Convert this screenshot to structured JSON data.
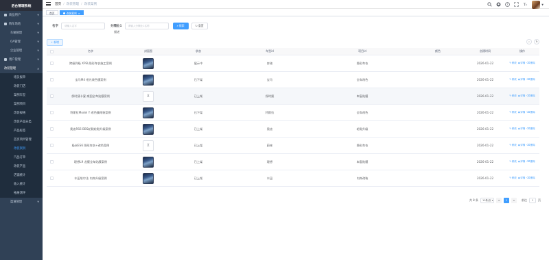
{
  "sidebar": {
    "logo": "后台管理系统",
    "items": [
      {
        "label": "商品用户",
        "level": "top",
        "icon": "user-icon"
      },
      {
        "label": "购车场地",
        "level": "top",
        "icon": "people-icon"
      },
      {
        "label": "车辆管理",
        "level": "sub"
      },
      {
        "label": "OA管理",
        "level": "sub"
      },
      {
        "label": "企业管理",
        "level": "sub"
      },
      {
        "label": "用户管理",
        "level": "top",
        "icon": "user-group-icon"
      },
      {
        "label": "改装管理",
        "level": "opened"
      },
      {
        "label": "增员报单",
        "level": "sub"
      },
      {
        "label": "改装门店",
        "level": "sub"
      },
      {
        "label": "案例车型",
        "level": "sub"
      },
      {
        "label": "案例项目",
        "level": "sub"
      },
      {
        "label": "改装规格",
        "level": "sub"
      },
      {
        "label": "改装产品分类",
        "level": "sub"
      },
      {
        "label": "产品标签",
        "level": "sub"
      },
      {
        "label": "首页项目管理",
        "level": "sub"
      },
      {
        "label": "改装案例",
        "level": "active"
      },
      {
        "label": "汽品订单",
        "level": "sub"
      },
      {
        "label": "改装产品",
        "level": "sub"
      },
      {
        "label": "店铺统计",
        "level": "sub"
      },
      {
        "label": "收入统计",
        "level": "sub"
      },
      {
        "label": "拓展测评",
        "level": "sub"
      },
      {
        "label": "渠道管理",
        "level": "sub"
      }
    ]
  },
  "navbar": {
    "breadcrumb": [
      "首页",
      "改装管理",
      "改装案例"
    ],
    "icons": [
      "search-icon",
      "github-icon",
      "question-icon",
      "fullscreen-icon",
      "font-size-icon"
    ]
  },
  "tags": [
    {
      "label": "首页",
      "active": false
    },
    {
      "label": "改装案例",
      "active": true
    }
  ],
  "search": {
    "name_label": "名字",
    "name_placeholder": "请输入名字",
    "cat_label": "分隔业1",
    "cat_placeholder": "请输入分隔业1名称",
    "search_btn": "搜索",
    "reset_btn": "重置",
    "extra_label": "描述"
  },
  "toolbar": {
    "add_btn": "+ 新增"
  },
  "table": {
    "headers": [
      "名字",
      "封面图",
      "状态",
      "车型id",
      "项目id",
      "颜色",
      "创建时间",
      "操作"
    ],
    "ops": [
      "修改",
      "详情",
      "删除"
    ],
    "rows": [
      {
        "name": "跨级到级 XPEL隐形车衣施工案例",
        "thumb": true,
        "status": "展示中",
        "brand": "奔驰",
        "series": "隐形车衣",
        "color": "",
        "date": "2026-01-22"
      },
      {
        "name": "宝马M4 哑光改色膜案例",
        "thumb": true,
        "status": "已下架",
        "brand": "宝马",
        "series": "全车改色",
        "color": "",
        "date": "2026-01-22"
      },
      {
        "name": "保时捷卡宴 威固全车贴膜案例",
        "thumb": false,
        "status": "已上架",
        "brand": "保时捷",
        "series": "车窗贴膜",
        "color": "",
        "date": "2026-01-22"
      },
      {
        "name": "特斯拉Model Y 改色膜改装案例",
        "thumb": true,
        "status": "已下架",
        "brand": "特斯拉",
        "series": "全车改色",
        "color": "",
        "date": "2026-01-22"
      },
      {
        "name": "奥迪RS6 BBS轮毂轮毂升级案例",
        "thumb": true,
        "status": "已上架",
        "brand": "奥迪",
        "series": "轮毂升级",
        "color": "",
        "date": "2026-01-22"
      },
      {
        "name": "极米ES6 隐形车衣+改色案例",
        "thumb": false,
        "status": "已上架",
        "brand": "蔚来",
        "series": "隐形车衣",
        "color": "",
        "date": "2026-01-22"
      },
      {
        "name": "理想L9 龙膜全车贴膜案例",
        "thumb": true,
        "status": "已上架",
        "brand": "理想",
        "series": "车窗贴膜",
        "color": "",
        "date": "2026-01-22"
      },
      {
        "name": "丰田埃尔法 内饰升级案例",
        "thumb": true,
        "status": "已上架",
        "brand": "丰田",
        "series": "内饰改装",
        "color": "",
        "date": "2026-01-22"
      }
    ]
  },
  "pagination": {
    "total": "共 8 条",
    "page_size": "10条/页",
    "prev": "<",
    "current": "1",
    "next": ">",
    "goto_label": "前往",
    "goto_value": "1",
    "page_unit": "页"
  }
}
